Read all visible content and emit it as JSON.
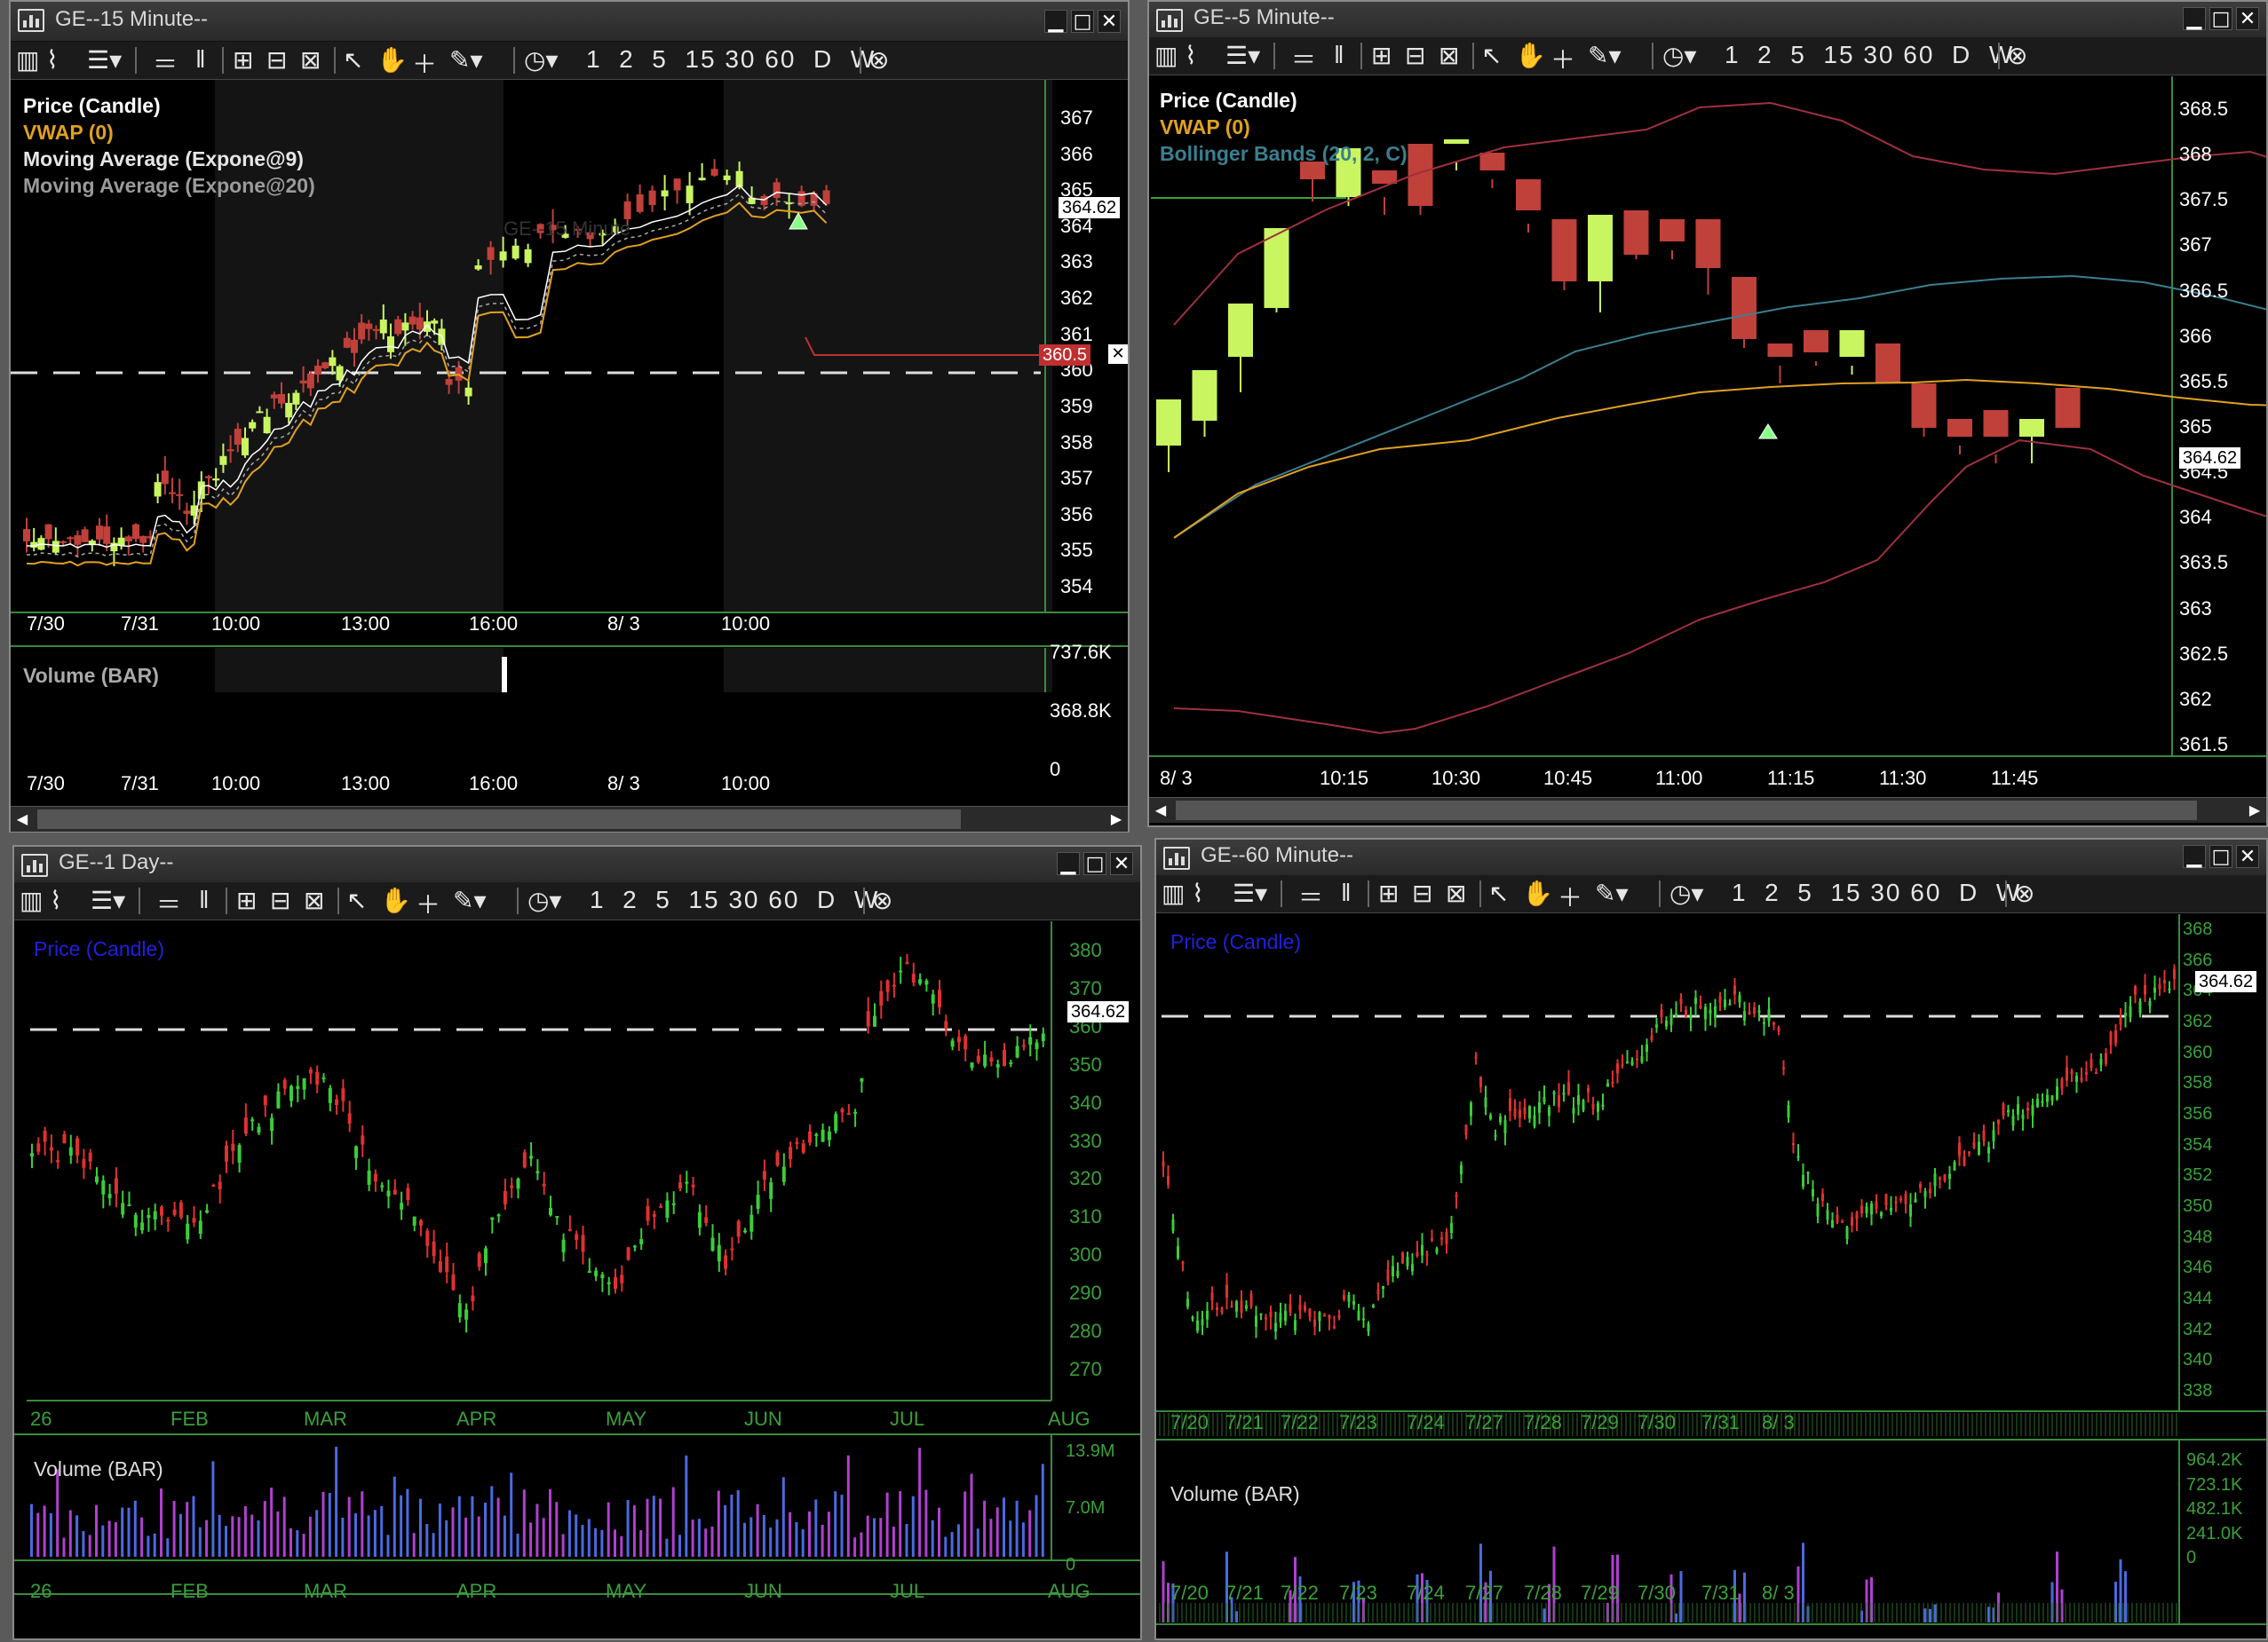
{
  "windows": {
    "w15": {
      "title": "GE--15 Minute--",
      "watermark": "GE--15 Minute",
      "legend": [
        "Price (Candle)",
        "VWAP (0)",
        "Moving Average (Expone@9)",
        "Moving Average (Expone@20)"
      ],
      "price_ticks": [
        "367",
        "366",
        "365",
        "364",
        "363",
        "362",
        "361",
        "360",
        "359",
        "358",
        "357",
        "356",
        "355",
        "354"
      ],
      "current_price": "364.62",
      "alert_price": "360.5",
      "time_labels": [
        "7/30",
        "7/31",
        "10:00",
        "13:00",
        "16:00",
        "8/ 3",
        "10:00"
      ],
      "volume_title": "Volume (BAR)",
      "volume_ticks": [
        "737.6K",
        "368.8K",
        "0"
      ]
    },
    "w5": {
      "title": "GE--5 Minute--",
      "legend": [
        "Price (Candle)",
        "VWAP (0)",
        "Bollinger Bands (20, 2, C)"
      ],
      "price_ticks": [
        "368.5",
        "368",
        "367.5",
        "367",
        "366.5",
        "366",
        "365.5",
        "365",
        "364.5",
        "364",
        "363.5",
        "363",
        "362.5",
        "362",
        "361.5"
      ],
      "current_price": "364.62",
      "time_labels": [
        "8/ 3",
        "10:15",
        "10:30",
        "10:45",
        "11:00",
        "11:15",
        "11:30",
        "11:45"
      ]
    },
    "w1d": {
      "title": "GE--1 Day--",
      "legend": [
        "Price (Candle)"
      ],
      "price_ticks": [
        "380",
        "370",
        "360",
        "350",
        "340",
        "330",
        "320",
        "310",
        "300",
        "290",
        "280",
        "270"
      ],
      "current_price": "364.62",
      "time_labels": [
        "26",
        "FEB",
        "MAR",
        "APR",
        "MAY",
        "JUN",
        "JUL",
        "AUG"
      ],
      "volume_title": "Volume (BAR)",
      "volume_ticks": [
        "13.9M",
        "7.0M",
        "0"
      ]
    },
    "w60": {
      "title": "GE--60 Minute--",
      "legend": [
        "Price (Candle)"
      ],
      "price_ticks": [
        "368",
        "366",
        "364",
        "362",
        "360",
        "358",
        "356",
        "354",
        "352",
        "350",
        "348",
        "346",
        "344",
        "342",
        "340",
        "338"
      ],
      "current_price": "364.62",
      "time_labels": [
        "7/20",
        "7/21",
        "7/22",
        "7/23",
        "7/24",
        "7/27",
        "7/28",
        "7/29",
        "7/30",
        "7/31",
        "8/ 3"
      ],
      "volume_title": "Volume (BAR)",
      "volume_ticks": [
        "964.2K",
        "723.1K",
        "482.1K",
        "241.0K",
        "0"
      ]
    }
  },
  "toolbar": {
    "periods": [
      "1",
      "2",
      "5",
      "15",
      "30",
      "60",
      "D",
      "W"
    ],
    "icons": [
      "chart-type-icon",
      "draw-line-icon",
      "layers-icon",
      "dropdown-icon",
      "hlines-icon",
      "vlines-icon",
      "zoom-in-icon",
      "zoom-out-icon",
      "zoom-fit-icon",
      "pointer-icon",
      "hand-icon",
      "crosshair-icon",
      "pen-icon",
      "clock-icon",
      "close-circle-icon"
    ]
  },
  "title_controls": {
    "minimize": "▁",
    "maximize": "□",
    "close": "✕"
  },
  "colors": {
    "up": "#c8f560",
    "down": "#c0403a",
    "vwap": "#e0a020",
    "ema9": "#ffffff",
    "ema20": "#aaaaaa",
    "bb_mid": "#3a7f8f",
    "bb_band": "#a03040",
    "grid_axis": "#3a8a3a",
    "legend_blue": "#2020e0"
  }
}
